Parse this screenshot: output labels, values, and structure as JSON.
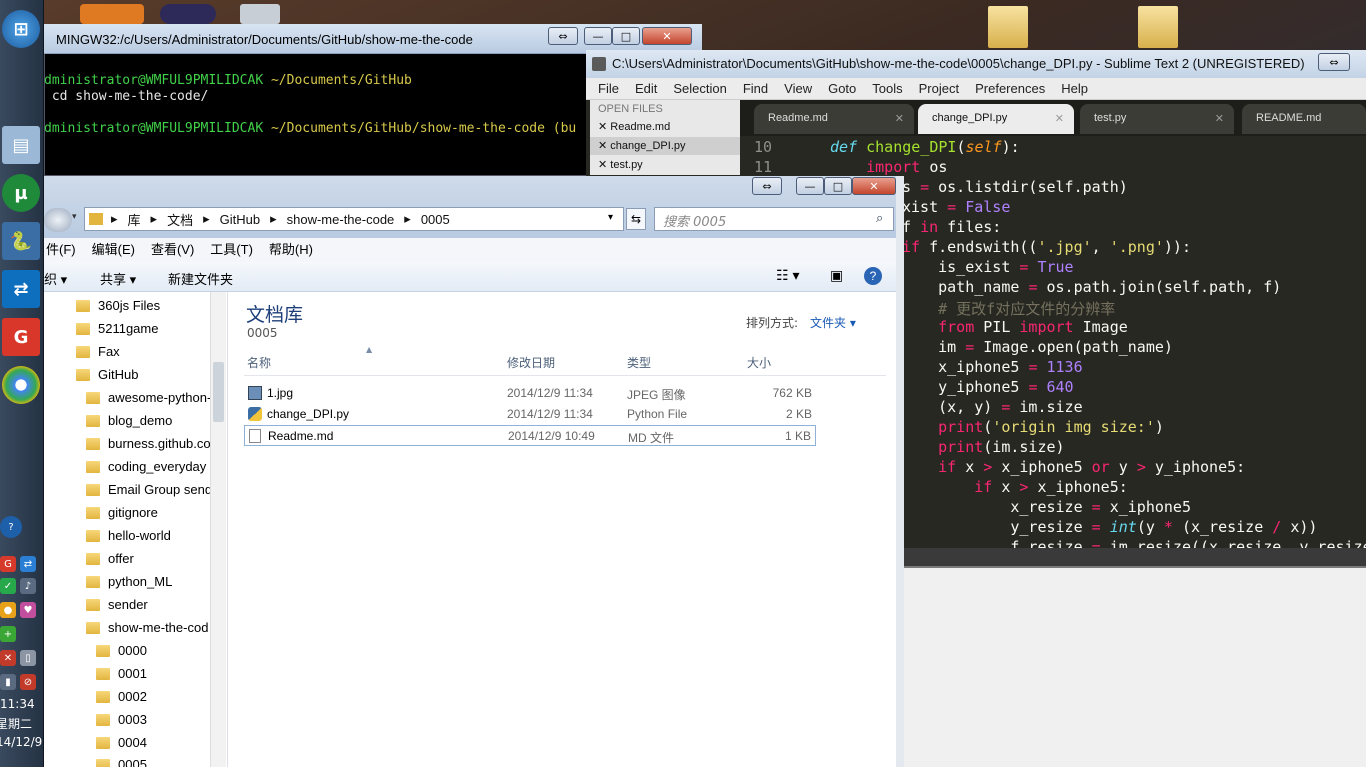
{
  "terminal": {
    "title": "MINGW32:/c/Users/Administrator/Documents/GitHub/show-me-the-code",
    "lines": [
      {
        "user": "dministrator@WMFUL9PMILIDCAK",
        "path": "~/Documents/GitHub"
      },
      {
        "cmd": " cd show-me-the-code/"
      },
      {
        "user": "dministrator@WMFUL9PMILIDCAK",
        "path": "~/Documents/GitHub/show-me-the-code (bu"
      }
    ]
  },
  "sublime": {
    "title": "C:\\Users\\Administrator\\Documents\\GitHub\\show-me-the-code\\0005\\change_DPI.py - Sublime Text 2 (UNREGISTERED)",
    "menu": [
      "File",
      "Edit",
      "Selection",
      "Find",
      "View",
      "Goto",
      "Tools",
      "Project",
      "Preferences",
      "Help"
    ],
    "open_files_label": "OPEN FILES",
    "open_files": [
      "Readme.md",
      "change_DPI.py",
      "test.py"
    ],
    "tabs": [
      "Readme.md",
      "change_DPI.py",
      "test.py",
      "README.md"
    ],
    "active_tab": "change_DPI.py",
    "line_numbers": [
      "10",
      "11"
    ],
    "code_lines": [
      {
        "t": "def change_DPI(self):"
      },
      {
        "t": "    import os"
      },
      {
        "t": "s = os.listdir(self.path)"
      },
      {
        "t": "xist = False"
      },
      {
        "t": "f in files:"
      },
      {
        "t": "if f.endswith(('.jpg', '.png')):"
      },
      {
        "t": "    is_exist = True"
      },
      {
        "t": "    path_name = os.path.join(self.path, f)"
      },
      {
        "t": "    # 更改f对应文件的分辨率"
      },
      {
        "t": "    from PIL import Image"
      },
      {
        "t": "    im = Image.open(path_name)"
      },
      {
        "t": "    x_iphone5 = 1136"
      },
      {
        "t": "    y_iphone5 = 640"
      },
      {
        "t": "    (x, y) = im.size"
      },
      {
        "t": "    print('origin img size:')"
      },
      {
        "t": "    print(im.size)"
      },
      {
        "t": "    if x > x_iphone5 or y > y_iphone5:"
      },
      {
        "t": "        if x > x_iphone5:"
      },
      {
        "t": "            x_resize = x_iphone5"
      },
      {
        "t": "            y_resize = int(y * (x_resize / x))"
      },
      {
        "t": "            f_resize = im.resize((x_resize, y_resize"
      }
    ]
  },
  "explorer": {
    "breadcrumb": [
      "库",
      "文档",
      "GitHub",
      "show-me-the-code",
      "0005"
    ],
    "search_placeholder": "搜索 0005",
    "menu": [
      "件(F)",
      "编辑(E)",
      "查看(V)",
      "工具(T)",
      "帮助(H)"
    ],
    "toolbar": {
      "organize": "织 ▾",
      "share": "共享 ▾",
      "new_folder": "新建文件夹"
    },
    "library_title": "文档库",
    "library_sub": "0005",
    "arrange_label": "排列方式:",
    "arrange_value": "文件夹 ▾",
    "columns": [
      "名称",
      "修改日期",
      "类型",
      "大小"
    ],
    "files": [
      {
        "name": "1.jpg",
        "date": "2014/12/9 11:34",
        "type": "JPEG 图像",
        "size": "762 KB"
      },
      {
        "name": "change_DPI.py",
        "date": "2014/12/9 11:34",
        "type": "Python File",
        "size": "2 KB"
      },
      {
        "name": "Readme.md",
        "date": "2014/12/9 10:49",
        "type": "MD 文件",
        "size": "1 KB"
      }
    ],
    "nav": [
      "360js Files",
      "5211game",
      "Fax",
      "GitHub",
      "awesome-python-",
      "blog_demo",
      "burness.github.co",
      "coding_everyday",
      "Email Group send",
      "gitignore",
      "hello-world",
      "offer",
      "python_ML",
      "sender",
      "show-me-the-cod",
      "0000",
      "0001",
      "0002",
      "0003",
      "0004",
      "0005"
    ]
  },
  "taskbar": {
    "time": "11:34",
    "day": "星期二",
    "date": "14/12/9"
  }
}
